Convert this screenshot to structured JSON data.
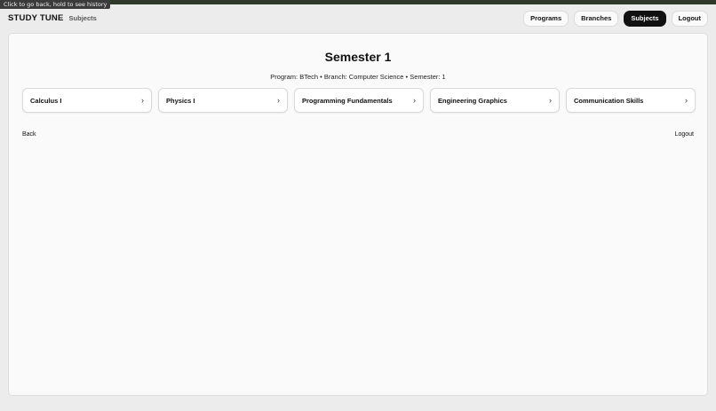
{
  "tooltip": "Click to go back, hold to see history",
  "header": {
    "brand": "STUDY TUNE",
    "section": "Subjects",
    "nav": [
      {
        "label": "Programs",
        "active": false
      },
      {
        "label": "Branches",
        "active": false
      },
      {
        "label": "Subjects",
        "active": true
      },
      {
        "label": "Logout",
        "active": false
      }
    ]
  },
  "main": {
    "title": "Semester 1",
    "meta": "Program: BTech • Branch: Computer Science • Semester: 1",
    "subjects": [
      {
        "label": "Calculus I",
        "arrow": "›"
      },
      {
        "label": "Physics I",
        "arrow": "›"
      },
      {
        "label": "Programming Fundamentals",
        "arrow": "›"
      },
      {
        "label": "Engineering Graphics",
        "arrow": "›"
      },
      {
        "label": "Communication Skills",
        "arrow": "›"
      }
    ],
    "back_label": "Back",
    "logout_label": "Logout"
  },
  "colors": {
    "active_nav_bg": "#111111",
    "page_bg": "#ececec",
    "panel_bg": "#fafafa"
  }
}
